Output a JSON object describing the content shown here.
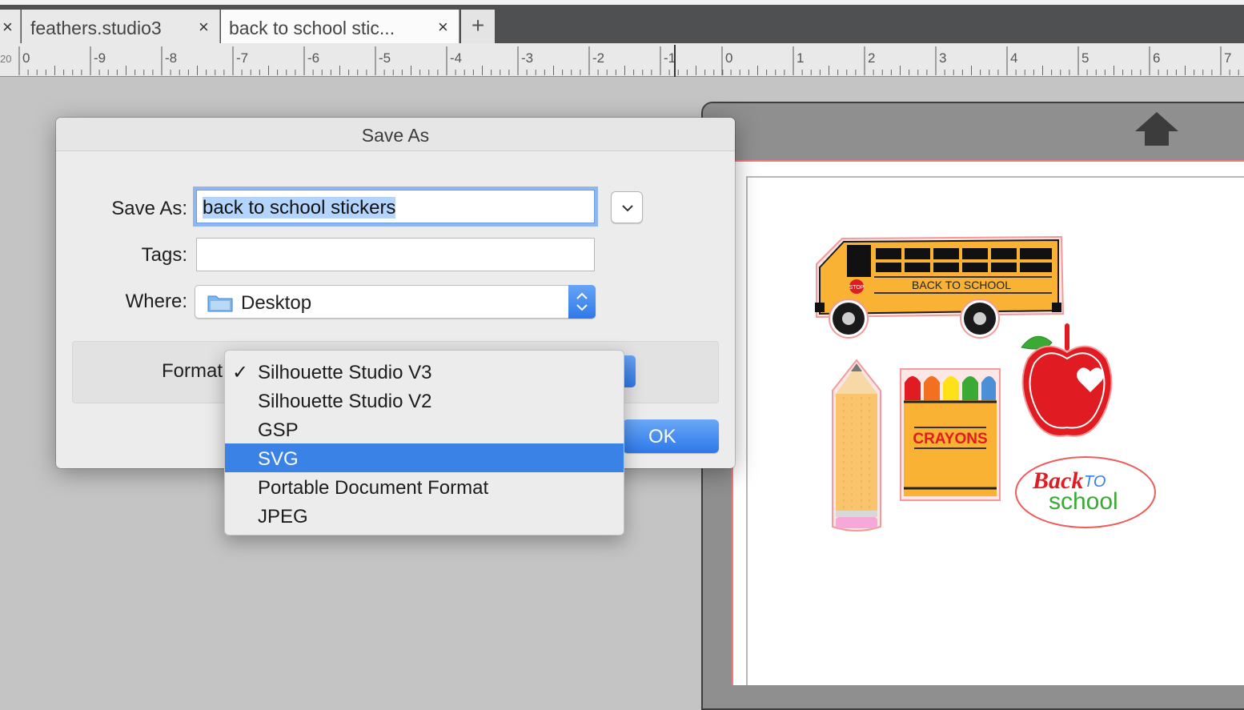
{
  "tabs": [
    {
      "close_glyph": "×",
      "label": ""
    },
    {
      "close_glyph": "×",
      "label": "feathers.studio3"
    },
    {
      "close_glyph": "×",
      "label": "back to school stic...",
      "active": true
    }
  ],
  "new_tab_glyph": "+",
  "ruler": {
    "corner_label": "20",
    "left_labels": [
      "0",
      "-9",
      "-8",
      "-7",
      "-6",
      "-5",
      "-4",
      "-3",
      "-2",
      "-1"
    ],
    "right_labels": [
      "0",
      "1",
      "2",
      "3",
      "4",
      "5",
      "6",
      "7"
    ]
  },
  "dialog": {
    "title": "Save As",
    "save_as_label": "Save As:",
    "save_as_value": "back to school stickers",
    "tags_label": "Tags:",
    "tags_value": "",
    "where_label": "Where:",
    "where_value": "Desktop",
    "format_label": "Format",
    "ok_label": "OK"
  },
  "format_menu": {
    "selected": "Silhouette Studio V3",
    "highlighted": "SVG",
    "items": [
      {
        "label": "Silhouette Studio V3",
        "checked": true
      },
      {
        "label": "Silhouette Studio V2"
      },
      {
        "label": "GSP"
      },
      {
        "label": "SVG",
        "highlighted": true
      },
      {
        "label": "Portable Document Format"
      },
      {
        "label": "JPEG"
      }
    ]
  },
  "canvas": {
    "bus_text": "BACK TO SCHOOL",
    "stop_text": "STOP",
    "crayons_text": "CRAYONS",
    "back_text": "Back",
    "to_text": "TO",
    "school_text": "school"
  },
  "colors": {
    "accent_blue": "#3b82e6",
    "tabbar": "#4f5051",
    "bus_yellow": "#f9b233",
    "apple_red": "#e11b22",
    "school_green": "#3aaa35"
  }
}
